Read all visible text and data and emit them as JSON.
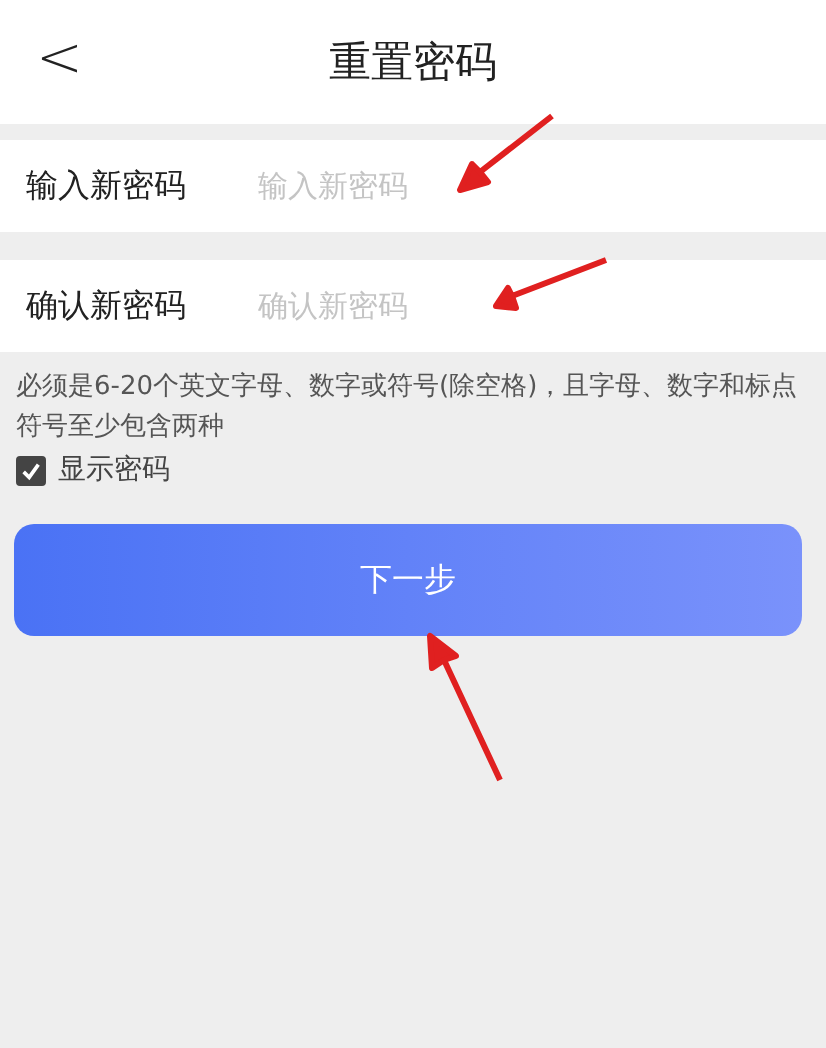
{
  "header": {
    "back": "<",
    "title": "重置密码"
  },
  "fields": [
    {
      "label": "输入新密码",
      "placeholder": "输入新密码"
    },
    {
      "label": "确认新密码",
      "placeholder": "确认新密码"
    }
  ],
  "hint": "必须是6-20个英文字母、数字或符号(除空格)，且字母、数字和标点符号至少包含两种",
  "show_password": {
    "label": "显示密码",
    "checked": true
  },
  "next_button": "下一步"
}
